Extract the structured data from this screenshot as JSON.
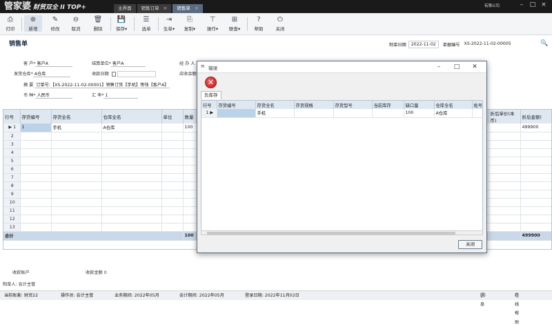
{
  "app": {
    "logo": "管家婆",
    "logo_sub": "财贸双全 II TOP+",
    "user": "有限公司",
    "tabs": [
      {
        "label": "主界面"
      },
      {
        "label": "销售订单"
      },
      {
        "label": "销售单"
      }
    ]
  },
  "toolbar": {
    "items": [
      {
        "label": "打印",
        "icon": "printer-icon"
      },
      {
        "label": "新增",
        "icon": "plus-icon"
      },
      {
        "label": "修改",
        "icon": "edit-icon"
      },
      {
        "label": "取消",
        "icon": "cancel-icon"
      },
      {
        "label": "删除",
        "icon": "trash-icon"
      },
      {
        "label": "保存",
        "icon": "save-icon"
      },
      {
        "label": "选单",
        "icon": "select-icon"
      },
      {
        "label": "生单",
        "icon": "generate-icon"
      },
      {
        "label": "复制",
        "icon": "copy-icon"
      },
      {
        "label": "操作",
        "icon": "operate-icon"
      },
      {
        "label": "联查",
        "icon": "query-icon"
      },
      {
        "label": "帮助",
        "icon": "help-icon"
      },
      {
        "label": "关闭",
        "icon": "power-icon"
      }
    ]
  },
  "page": {
    "title": "销售单",
    "doc_date_label": "制单日期",
    "doc_date": "2022-11-02",
    "doc_no_label": "单据编号",
    "doc_no": "XS-2022-11-02-00005"
  },
  "form": {
    "customer_label": "客  户*",
    "customer": "客户A",
    "settle_label": "结算单位*",
    "settle": "客户A",
    "handler_label": "经 办 人",
    "warehouse_label": "发货仓库*",
    "warehouse": "A仓库",
    "receipt_date_label": "收款日期",
    "receivable_label": "应收余额",
    "remark_label": "摘  要",
    "remark": "订单号:【XS-2022-11-02-00001】销售订货【手机】等钱【客户A】",
    "currency_label": "币  种*",
    "currency": "人民币",
    "rate_label": "汇  率*",
    "rate": "1"
  },
  "grid": {
    "headers": [
      "行号",
      "存货编号",
      "存货全名",
      "仓库全名",
      "单位",
      "数量",
      "折后单价(本币)",
      "折后金额("
    ],
    "rows": [
      {
        "no": "1",
        "code": "1",
        "name": "手机",
        "wh": "A仓库",
        "unit": "",
        "qty": "100",
        "price": "",
        "amount": "499900"
      },
      {
        "no": "2"
      },
      {
        "no": "3"
      },
      {
        "no": "4"
      },
      {
        "no": "5"
      },
      {
        "no": "6"
      },
      {
        "no": "7"
      },
      {
        "no": "8"
      },
      {
        "no": "9"
      },
      {
        "no": "10"
      },
      {
        "no": "11"
      },
      {
        "no": "12"
      },
      {
        "no": "13"
      }
    ],
    "total_label": "合计",
    "total_qty": "100",
    "total_amount": "499900"
  },
  "bottom": {
    "account_label": "收款账户",
    "amount_label": "收款金额",
    "amount": "0",
    "maker": "制单人: 会计主管"
  },
  "status": {
    "account": "当前账套: 财贸22",
    "operator": "操作员: 会计主管",
    "period": "业务期间: 2022年05月",
    "acct_period": "会计期间: 2022年05月",
    "login": "登录日期: 2022年11月02日",
    "message": "消息",
    "help": "在线帮助"
  },
  "dialog": {
    "title": "错误",
    "tab": "负库存",
    "headers": [
      "行号",
      "存货编号",
      "存货全名",
      "存货规格",
      "存货型号",
      "当前库存",
      "缺口量",
      "仓库全名",
      "批号"
    ],
    "rows": [
      {
        "no": "1",
        "code": "",
        "name": "手机",
        "spec": "",
        "model": "",
        "stock": "",
        "gap": "100",
        "wh": "A仓库",
        "batch": ""
      }
    ],
    "close_label": "关闭"
  }
}
